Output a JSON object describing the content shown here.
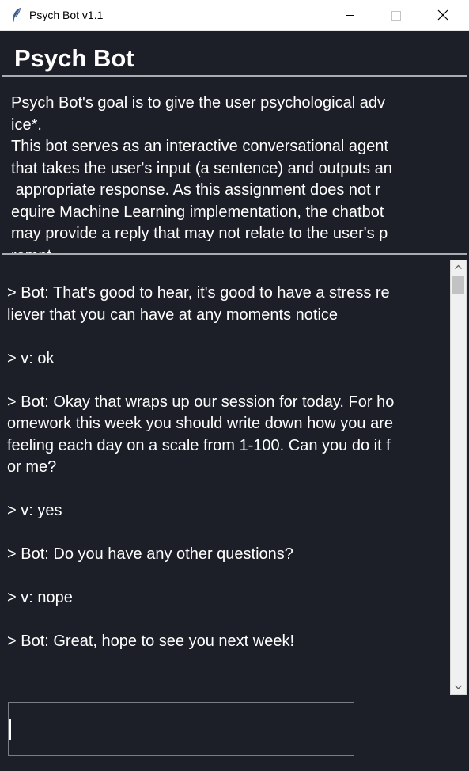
{
  "window": {
    "title": "Psych Bot v1.1",
    "icon": "feather-icon",
    "controls": [
      "minimize-icon",
      "maximize-icon",
      "close-icon"
    ]
  },
  "header": {
    "title": "Psych Bot"
  },
  "description": {
    "lines": [
      "Psych Bot's goal is to give the user psychological adv",
      "ice*.",
      "This bot serves as an interactive conversational agent",
      "that takes the user's input (a sentence) and outputs an",
      " appropriate response. As this assignment does not r",
      "equire Machine Learning implementation, the chatbot",
      "may provide a reply that may not relate to the user's p",
      "rompt"
    ]
  },
  "chat": {
    "lines": [
      "> Bot: That's good to hear, it's good to have a stress re",
      "liever that you can have at any moments notice",
      "",
      "> v: ok",
      "",
      "> Bot: Okay that wraps up our session for today. For ho",
      "omework this week you should write down how you are",
      "feeling each day on a scale from 1-100. Can you do it f",
      "or me?",
      "",
      "> v: yes",
      "",
      "> Bot: Do you have any other questions?",
      "",
      "> v: nope",
      "",
      "> Bot: Great, hope to see you next week!"
    ]
  },
  "input": {
    "value": ""
  },
  "colors": {
    "background": "#1c1e28",
    "text": "#ffffff",
    "rule": "#a9acb3"
  }
}
